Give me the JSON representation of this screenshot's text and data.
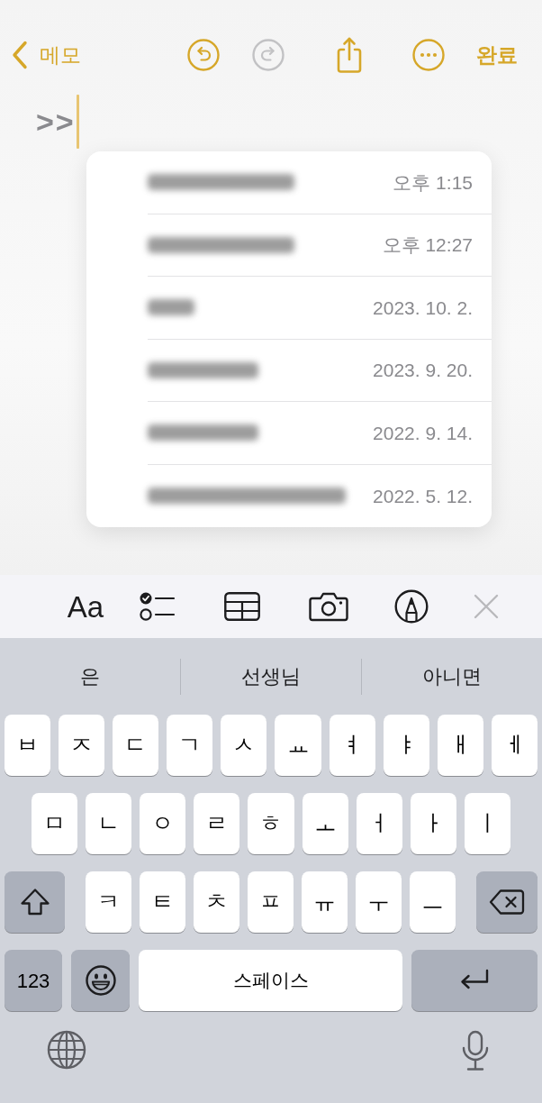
{
  "nav": {
    "back_label": "메모",
    "undo": {
      "disabled": false
    },
    "redo": {
      "disabled": true
    },
    "done_label": "완료"
  },
  "note": {
    "text": ">>"
  },
  "link_suggestions": [
    {
      "title_redacted": true,
      "date": "오후 1:15"
    },
    {
      "title_redacted": true,
      "date": "오후 12:27"
    },
    {
      "title_redacted": true,
      "date": "2023. 10. 2."
    },
    {
      "title_redacted": true,
      "date": "2023. 9. 20."
    },
    {
      "title_redacted": true,
      "date": "2022. 9. 14."
    },
    {
      "title_redacted": true,
      "date": "2022. 5. 12."
    }
  ],
  "toolbar": {
    "format_label": "Aa"
  },
  "keyboard": {
    "suggestions": [
      "은",
      "선생님",
      "아니면"
    ],
    "letter_rows": [
      [
        "ㅂ",
        "ㅈ",
        "ㄷ",
        "ㄱ",
        "ㅅ",
        "ㅛ",
        "ㅕ",
        "ㅑ",
        "ㅐ",
        "ㅔ"
      ],
      [
        "ㅁ",
        "ㄴ",
        "ㅇ",
        "ㄹ",
        "ㅎ",
        "ㅗ",
        "ㅓ",
        "ㅏ",
        "ㅣ"
      ],
      [
        "ㅋ",
        "ㅌ",
        "ㅊ",
        "ㅍ",
        "ㅠ",
        "ㅜ",
        "ㅡ"
      ]
    ],
    "numbers_key": "123",
    "space_key": "스페이스"
  }
}
